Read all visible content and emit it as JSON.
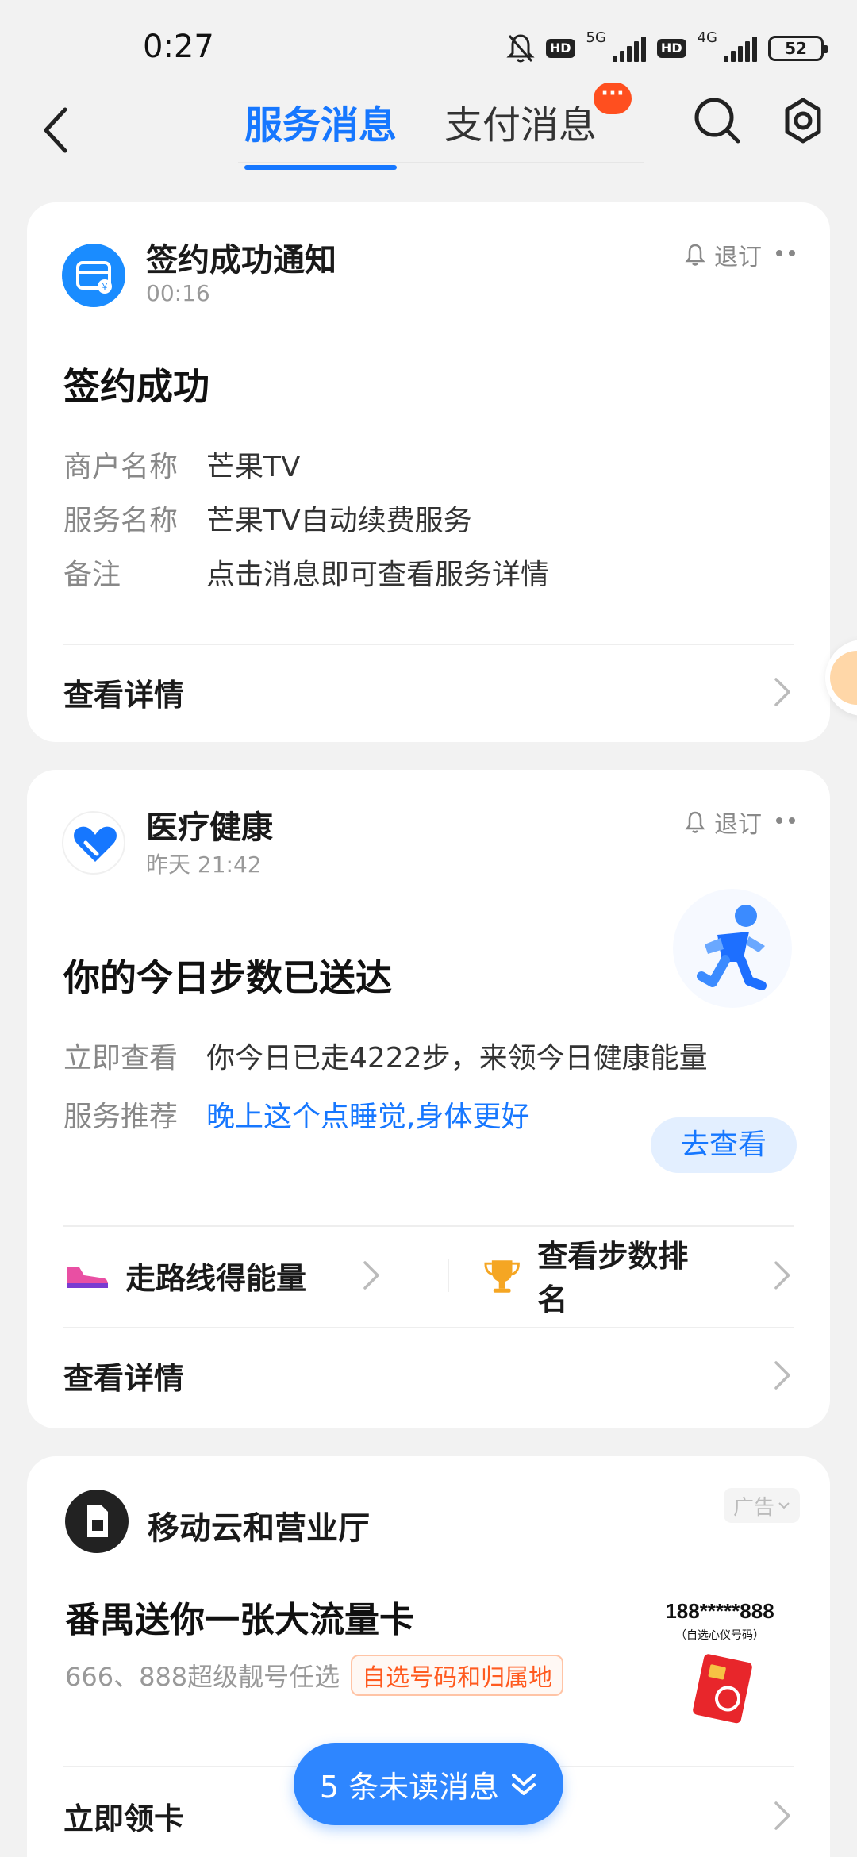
{
  "status_bar": {
    "time": "0:27",
    "net1": "5G",
    "net2": "4G",
    "hd": "HD",
    "battery": "52"
  },
  "header": {
    "tab_service": "服务消息",
    "tab_pay": "支付消息",
    "badge": "···"
  },
  "card1": {
    "source": "签约成功通知",
    "time": "00:16",
    "unsubscribe": "退订",
    "title": "签约成功",
    "rows": [
      {
        "k": "商户名称",
        "v": "芒果TV"
      },
      {
        "k": "服务名称",
        "v": "芒果TV自动续费服务"
      },
      {
        "k": "备注",
        "v": "点击消息即可查看服务详情"
      }
    ],
    "detail": "查看详情"
  },
  "card2": {
    "source": "医疗健康",
    "time": "昨天 21:42",
    "unsubscribe": "退订",
    "title": "你的今日步数已送达",
    "rows": [
      {
        "k": "立即查看",
        "v": "你今日已走4222步，来领今日健康能量"
      },
      {
        "k": "服务推荐",
        "v": "晚上这个点睡觉,身体更好"
      }
    ],
    "go_button": "去查看",
    "action_left": "走路线得能量",
    "action_right": "查看步数排名",
    "detail": "查看详情"
  },
  "card3": {
    "source": "移动云和营业厅",
    "ad": "广告",
    "title": "番禺送你一张大流量卡",
    "subtitle": "666、888超级靓号任选",
    "tag": "自选号码和归属地",
    "promo_number": "188*****888",
    "promo_sub": "（自选心仪号码）",
    "detail": "立即领卡"
  },
  "unread": {
    "label": "5 条未读消息"
  },
  "colors": {
    "accent": "#1677ff",
    "badge": "#ff4f1f",
    "pill": "#2e86ff"
  }
}
